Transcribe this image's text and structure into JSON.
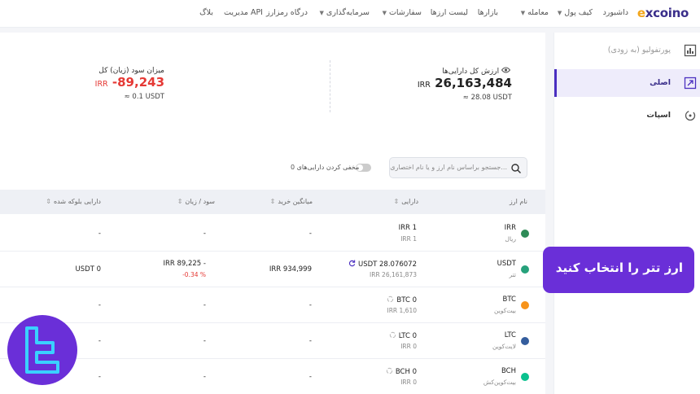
{
  "nav": {
    "logo": "excoino",
    "items": [
      {
        "label": "داشبورد",
        "dropdown": false
      },
      {
        "label": "کیف پول",
        "dropdown": true
      },
      {
        "label": "معامله",
        "dropdown": true
      },
      {
        "label": "بازارها",
        "dropdown": false
      },
      {
        "label": "لیست ارزها",
        "dropdown": false
      },
      {
        "label": "سفارشات",
        "dropdown": true
      },
      {
        "label": "سرمایه‌گذاری",
        "dropdown": true
      },
      {
        "label": "درگاه رمزارز",
        "dropdown": false
      },
      {
        "label": "مدیریت API",
        "dropdown": false
      },
      {
        "label": "بلاگ",
        "dropdown": false
      }
    ]
  },
  "sidebar": {
    "items": [
      {
        "label": "پورتفولیو (به زودی)",
        "icon": "chart-icon"
      },
      {
        "label": "اصلی",
        "icon": "wallet-icon",
        "active": true
      },
      {
        "label": "اسپات",
        "icon": "exchange-icon"
      }
    ]
  },
  "summary": {
    "total_title": "ارزش کل دارایی‌ها",
    "total_value": "26,163,484",
    "total_currency": "IRR",
    "total_usdt": "≈ 28.08 USDT",
    "pnl_title": "میزان سود (زیان) کل",
    "pnl_value": "-89,243",
    "pnl_currency": "IRR",
    "pnl_usdt": "≈ 0.1 USDT"
  },
  "filters": {
    "search_placeholder": "جستجو براساس نام ارز و یا نام اختصاری...",
    "hide_label": "مخفی کردن دارایی‌های 0"
  },
  "table": {
    "headers": {
      "name": "نام ارز",
      "asset": "دارایی",
      "avg": "میانگین خرید",
      "pnl": "سود / زیان",
      "locked": "دارایی بلوکه شده"
    },
    "rows": [
      {
        "symbol": "IRR",
        "name": "ریال",
        "color": "#2e8b57",
        "asset": "IRR 1",
        "asset_irr": "IRR 1",
        "avg": "-",
        "pnl": "-",
        "pnl_pct": "",
        "locked": "-"
      },
      {
        "symbol": "USDT",
        "name": "تتر",
        "color": "#26a17b",
        "asset": "USDT 28.076072",
        "asset_irr": "IRR 26,161,873",
        "avg": "IRR 934,999",
        "pnl": "IRR 89,225 -",
        "pnl_pct": "-0.34 %",
        "locked": "USDT 0"
      },
      {
        "symbol": "BTC",
        "name": "بیت‌کوین",
        "color": "#f7931a",
        "asset": "BTC 0",
        "asset_irr": "IRR 1,610",
        "avg": "-",
        "pnl": "-",
        "pnl_pct": "",
        "locked": "-"
      },
      {
        "symbol": "LTC",
        "name": "لایت‌کوین",
        "color": "#345d9d",
        "asset": "LTC 0",
        "asset_irr": "IRR 0",
        "avg": "-",
        "pnl": "-",
        "pnl_pct": "",
        "locked": "-"
      },
      {
        "symbol": "BCH",
        "name": "بیت‌کوین‌کش",
        "color": "#0ac18e",
        "asset": "BCH 0",
        "asset_irr": "IRR 0",
        "avg": "-",
        "pnl": "-",
        "pnl_pct": "",
        "locked": "-"
      }
    ]
  },
  "callout": {
    "text": "ارز تتر را انتخاب کنید"
  },
  "colors": {
    "accent": "#4a2fc0",
    "callout": "#6a2fd8",
    "negative": "#e53935"
  }
}
